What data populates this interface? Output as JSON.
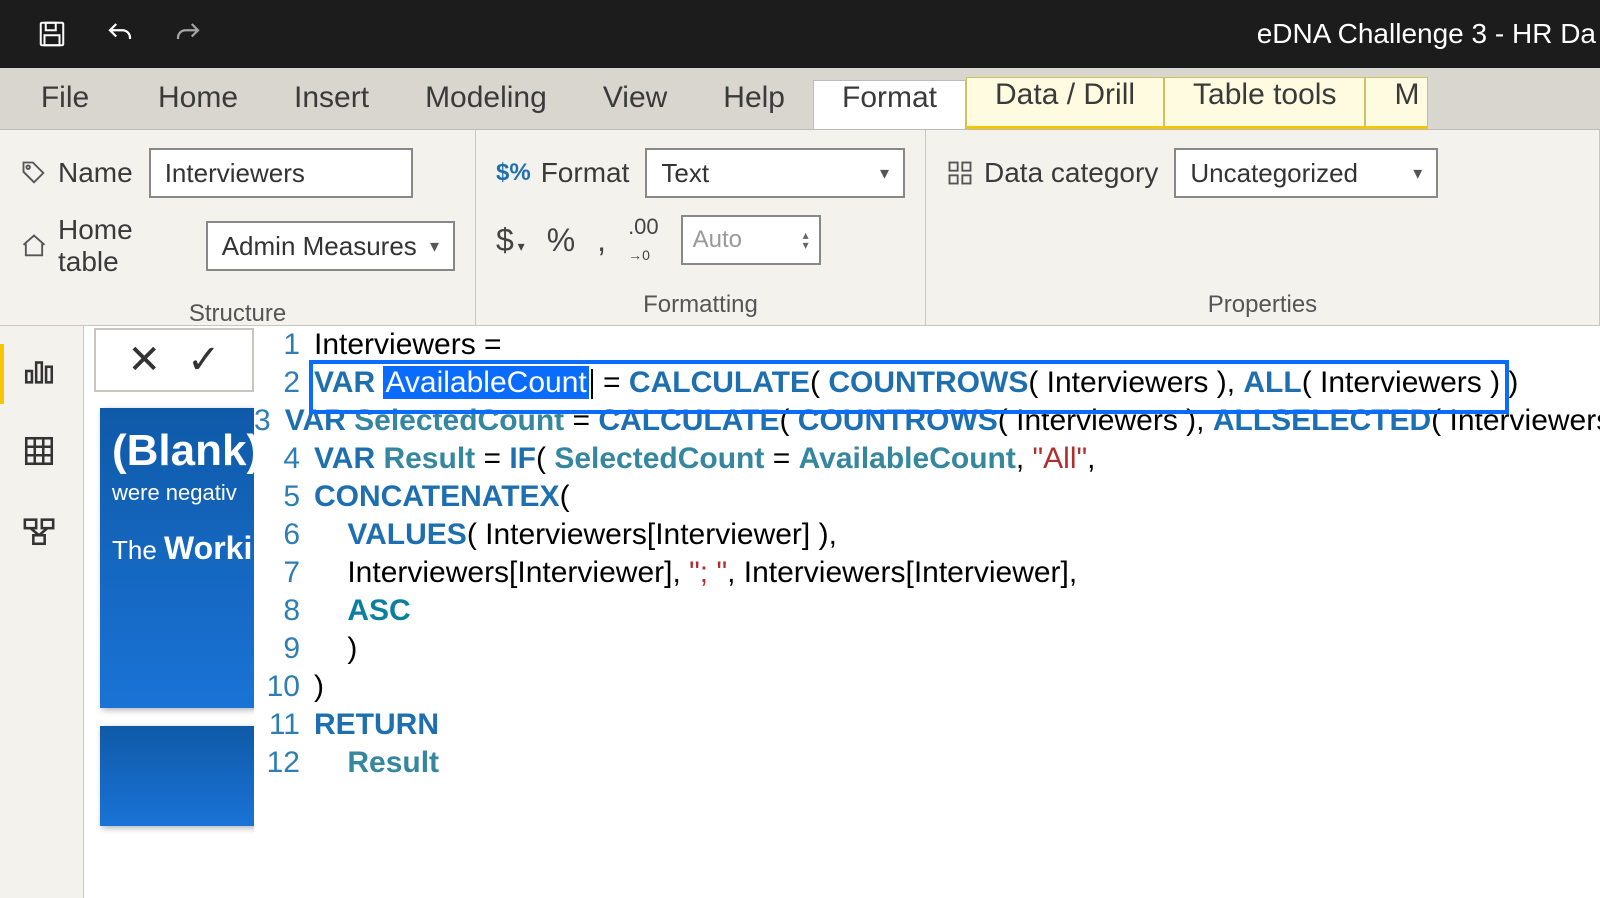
{
  "titlebar": {
    "title": "eDNA Challenge 3 - HR Da"
  },
  "tabs": {
    "file": "File",
    "items": [
      "Home",
      "Insert",
      "Modeling",
      "View",
      "Help",
      "Format",
      "Data / Drill",
      "Table tools"
    ],
    "partial": "M",
    "active_index": 5,
    "yellow_indices": [
      6,
      7
    ]
  },
  "ribbon": {
    "structure": {
      "label": "Structure",
      "name_label": "Name",
      "name_value": "Interviewers",
      "hometable_label": "Home table",
      "hometable_value": "Admin Measures"
    },
    "formatting": {
      "label": "Formatting",
      "format_label": "Format",
      "format_value": "Text",
      "decimals_value": "Auto",
      "currency_glyph": "$",
      "percent_glyph": "%",
      "comma_glyph": ","
    },
    "properties": {
      "label": "Properties",
      "datacat_label": "Data category",
      "datacat_value": "Uncategorized"
    }
  },
  "bluecard": {
    "blank": "(Blank)",
    "line1": "were negativ",
    "line2_prefix": "The ",
    "line2_bold": "Worki"
  },
  "formula": {
    "lines": [
      {
        "n": 1,
        "tokens": [
          [
            "plain",
            "Interviewers = "
          ]
        ]
      },
      {
        "n": 2,
        "tokens": [
          [
            "var",
            "VAR "
          ],
          [
            "sel",
            "AvailableCount"
          ],
          [
            "cursor",
            ""
          ],
          [
            "plain",
            " = "
          ],
          [
            "kw",
            "CALCULATE"
          ],
          [
            "plain",
            "( "
          ],
          [
            "kw",
            "COUNTROWS"
          ],
          [
            "plain",
            "( Interviewers ), "
          ],
          [
            "kw",
            "ALL"
          ],
          [
            "plain",
            "( Interviewers ) )"
          ]
        ]
      },
      {
        "n": 3,
        "tokens": [
          [
            "var",
            "VAR "
          ],
          [
            "varname",
            "SelectedCount"
          ],
          [
            "plain",
            " = "
          ],
          [
            "kw",
            "CALCULATE"
          ],
          [
            "plain",
            "( "
          ],
          [
            "kw",
            "COUNTROWS"
          ],
          [
            "plain",
            "( Interviewers ), "
          ],
          [
            "kw",
            "ALLSELECTED"
          ],
          [
            "plain",
            "( Interviewers ) )"
          ]
        ]
      },
      {
        "n": 4,
        "tokens": [
          [
            "var",
            "VAR "
          ],
          [
            "varname",
            "Result"
          ],
          [
            "plain",
            " = "
          ],
          [
            "kw",
            "IF"
          ],
          [
            "plain",
            "( "
          ],
          [
            "varname",
            "SelectedCount"
          ],
          [
            "plain",
            " = "
          ],
          [
            "varname",
            "AvailableCount"
          ],
          [
            "plain",
            ", "
          ],
          [
            "str",
            "\"All\""
          ],
          [
            "plain",
            ","
          ]
        ]
      },
      {
        "n": 5,
        "tokens": [
          [
            "kw",
            "CONCATENATEX"
          ],
          [
            "plain",
            "("
          ]
        ]
      },
      {
        "n": 6,
        "tokens": [
          [
            "plain",
            "    "
          ],
          [
            "kw",
            "VALUES"
          ],
          [
            "plain",
            "( Interviewers[Interviewer] ),"
          ]
        ]
      },
      {
        "n": 7,
        "tokens": [
          [
            "plain",
            "    Interviewers[Interviewer], "
          ],
          [
            "str",
            "\"; \""
          ],
          [
            "plain",
            ", Interviewers[Interviewer],"
          ]
        ]
      },
      {
        "n": 8,
        "tokens": [
          [
            "plain",
            "    "
          ],
          [
            "kw2",
            "ASC"
          ]
        ]
      },
      {
        "n": 9,
        "tokens": [
          [
            "plain",
            "    )"
          ]
        ]
      },
      {
        "n": 10,
        "tokens": [
          [
            "plain",
            ")"
          ]
        ]
      },
      {
        "n": 11,
        "tokens": [
          [
            "var",
            "RETURN"
          ]
        ]
      },
      {
        "n": 12,
        "tokens": [
          [
            "plain",
            "    "
          ],
          [
            "varname",
            "Result"
          ]
        ]
      }
    ],
    "highlight_line": 2
  }
}
